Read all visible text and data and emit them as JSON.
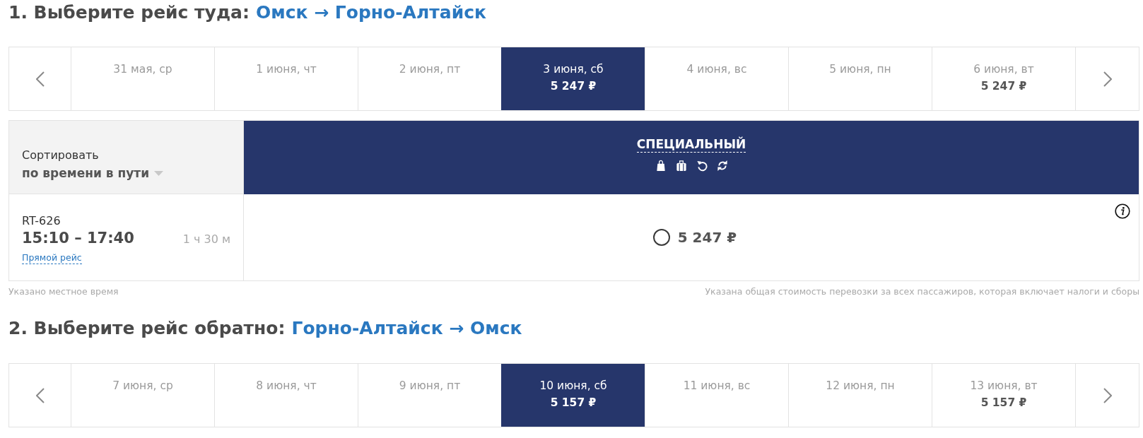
{
  "sections": [
    {
      "heading": "1. Выберите рейс туда:",
      "route": "Омск → Горно-Алтайск",
      "dates": [
        {
          "label": "31 мая, ср",
          "selected": false
        },
        {
          "label": "1 июня, чт",
          "selected": false
        },
        {
          "label": "2 июня, пт",
          "selected": false
        },
        {
          "label": "3 июня, сб",
          "price": "5 247 ₽",
          "selected": true
        },
        {
          "label": "4 июня, вс",
          "selected": false
        },
        {
          "label": "5 июня, пн",
          "selected": false
        },
        {
          "label": "6 июня, вт",
          "price": "5 247 ₽",
          "selected": false
        }
      ],
      "table": {
        "sort_label": "Сортировать",
        "sort_value": "по времени в пути",
        "fares": [
          {
            "name": "СПЕЦИАЛЬНЫЙ"
          }
        ],
        "flights": [
          {
            "number": "RT-626",
            "time": "15:10 – 17:40",
            "duration": "1 ч 30 м",
            "link": "Прямой рейс",
            "prices": [
              {
                "price": "5 247 ₽",
                "selected": false
              }
            ]
          }
        ]
      },
      "notes": {
        "left": "Указано местное время",
        "right": "Указана общая стоимость перевозки за всех пассажиров, которая включает налоги и сборы"
      }
    },
    {
      "heading": "2. Выберите рейс обратно:",
      "route": "Горно-Алтайск → Омск",
      "dates": [
        {
          "label": "7 июня, ср",
          "selected": false
        },
        {
          "label": "8 июня, чт",
          "selected": false
        },
        {
          "label": "9 июня, пт",
          "selected": false
        },
        {
          "label": "10 июня, сб",
          "price": "5 157 ₽",
          "selected": true
        },
        {
          "label": "11 июня, вс",
          "selected": false
        },
        {
          "label": "12 июня, пн",
          "selected": false
        },
        {
          "label": "13 июня, вт",
          "price": "5 157 ₽",
          "selected": false
        }
      ]
    }
  ]
}
